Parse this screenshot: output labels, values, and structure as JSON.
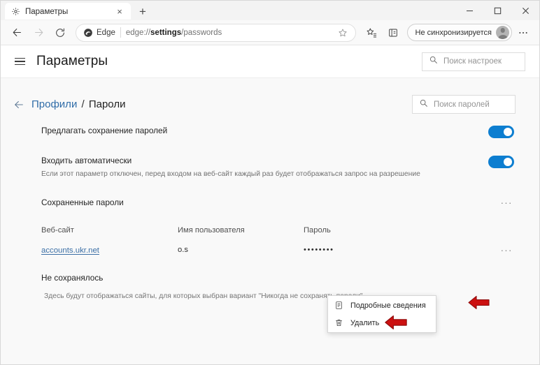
{
  "browser": {
    "tab": {
      "title": "Параметры",
      "favicon": "gear-icon",
      "close_label": "×"
    },
    "new_tab_label": "+",
    "window_controls": {
      "minimize": "minimize-icon",
      "maximize": "maximize-icon",
      "close": "close-icon"
    },
    "nav": {
      "back": "back-arrow-icon",
      "forward": "forward-arrow-icon",
      "reload": "reload-icon"
    },
    "omnibox": {
      "brand_label": "Edge",
      "url_prefix": "edge://",
      "url_bold": "settings",
      "url_suffix": "/passwords",
      "favorite_icon": "star-icon"
    },
    "toolbar_icons": {
      "favorites": "star-list-icon",
      "collections": "collections-icon",
      "more": "ellipsis-icon"
    },
    "profile": {
      "label": "Не синхронизируется",
      "avatar": "person-avatar"
    }
  },
  "settings": {
    "hamburger": "hamburger-menu-icon",
    "title": "Параметры",
    "search": {
      "placeholder": "Поиск настроек",
      "icon": "search-icon"
    }
  },
  "passwords_page": {
    "back_icon": "back-arrow-icon",
    "breadcrumb": {
      "parent": "Профили",
      "separator": "/",
      "current": "Пароли"
    },
    "search": {
      "placeholder": "Поиск паролей",
      "icon": "search-icon"
    },
    "toggles": [
      {
        "label": "Предлагать сохранение паролей",
        "description": "",
        "state": "on"
      },
      {
        "label": "Входить автоматически",
        "description": "Если этот параметр отключен, перед входом на веб-сайт каждый раз будет отображаться запрос на разрешение",
        "state": "on"
      }
    ],
    "saved_section": {
      "title": "Сохраненные пароли",
      "more_label": "···"
    },
    "table": {
      "columns": [
        "Веб-сайт",
        "Имя пользователя",
        "Пароль"
      ],
      "rows": [
        {
          "site": "accounts.ukr.net",
          "username": "o.s",
          "password": "••••••••",
          "row_more_label": "···"
        }
      ]
    },
    "context_menu": {
      "items": [
        {
          "label": "Подробные сведения",
          "icon": "details-document-icon"
        },
        {
          "label": "Удалить",
          "icon": "trash-icon"
        }
      ]
    },
    "not_saved_section": {
      "title": "Не сохранялось",
      "description": "Здесь будут отображаться сайты, для которых выбран вариант \"Никогда не сохранять пароли\""
    }
  },
  "annotations": {
    "arrow_color": "#cc1111",
    "arrow_row_target": "row-more-button",
    "arrow_menu_target": "delete-menu-item"
  },
  "colors": {
    "accent": "#0d7ed0",
    "link": "#3a6ea5",
    "breadcrumb_link": "#2f6ca8"
  }
}
